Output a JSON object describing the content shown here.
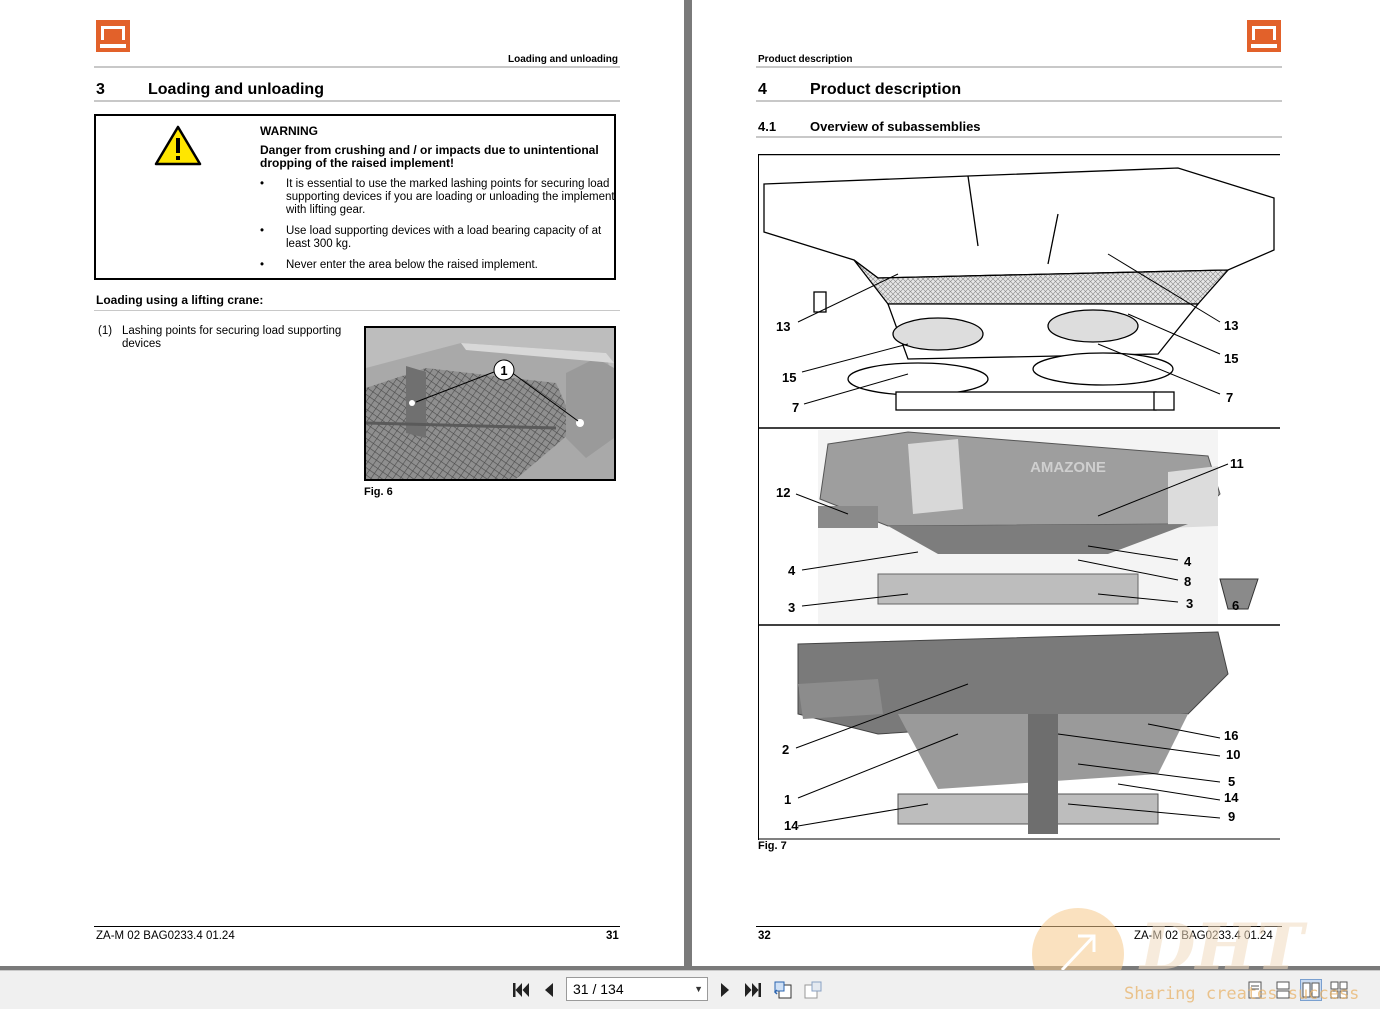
{
  "left_page": {
    "header": "Loading and unloading",
    "section_number": "3",
    "section_title": "Loading and unloading",
    "warning": {
      "title": "WARNING",
      "subtitle": "Danger from crushing and / or impacts due to unintentional dropping of the raised implement!",
      "items": [
        "It is essential to use the marked lashing points for securing load supporting devices if you are loading or unloading the implement with lifting gear.",
        "Use load supporting devices with a load bearing capacity of at least 300 kg.",
        "Never enter the area below the raised implement."
      ]
    },
    "subheading": "Loading using a lifting crane:",
    "legend_num": "(1)",
    "legend_text": "Lashing points for securing load supporting devices",
    "figure_callout": "1",
    "figure_caption": "Fig. 6",
    "footer_left": "ZA-M 02  BAG0233.4  01.24",
    "footer_page": "31"
  },
  "right_page": {
    "header": "Product description",
    "section_number": "4",
    "section_title": "Product description",
    "subsection_number": "4.1",
    "subsection_title": "Overview of subassemblies",
    "figure_caption": "Fig. 7",
    "panel1_callouts": [
      "13",
      "15",
      "7",
      "13",
      "15",
      "7"
    ],
    "panel2_callouts": [
      "12",
      "4",
      "3",
      "11",
      "4",
      "8",
      "3",
      "6"
    ],
    "panel2_brand": "AMAZONE",
    "panel3_callouts": [
      "2",
      "1",
      "14",
      "16",
      "10",
      "5",
      "14",
      "9"
    ],
    "footer_page": "32",
    "footer_right": "ZA-M 02  BAG0233.4  01.24"
  },
  "toolbar": {
    "page_indicator": "31 / 134",
    "first_icon": "first-page-icon",
    "prev_icon": "previous-page-icon",
    "next_icon": "next-page-icon",
    "last_icon": "last-page-icon"
  },
  "watermark": {
    "text": "Sharing creates success"
  }
}
